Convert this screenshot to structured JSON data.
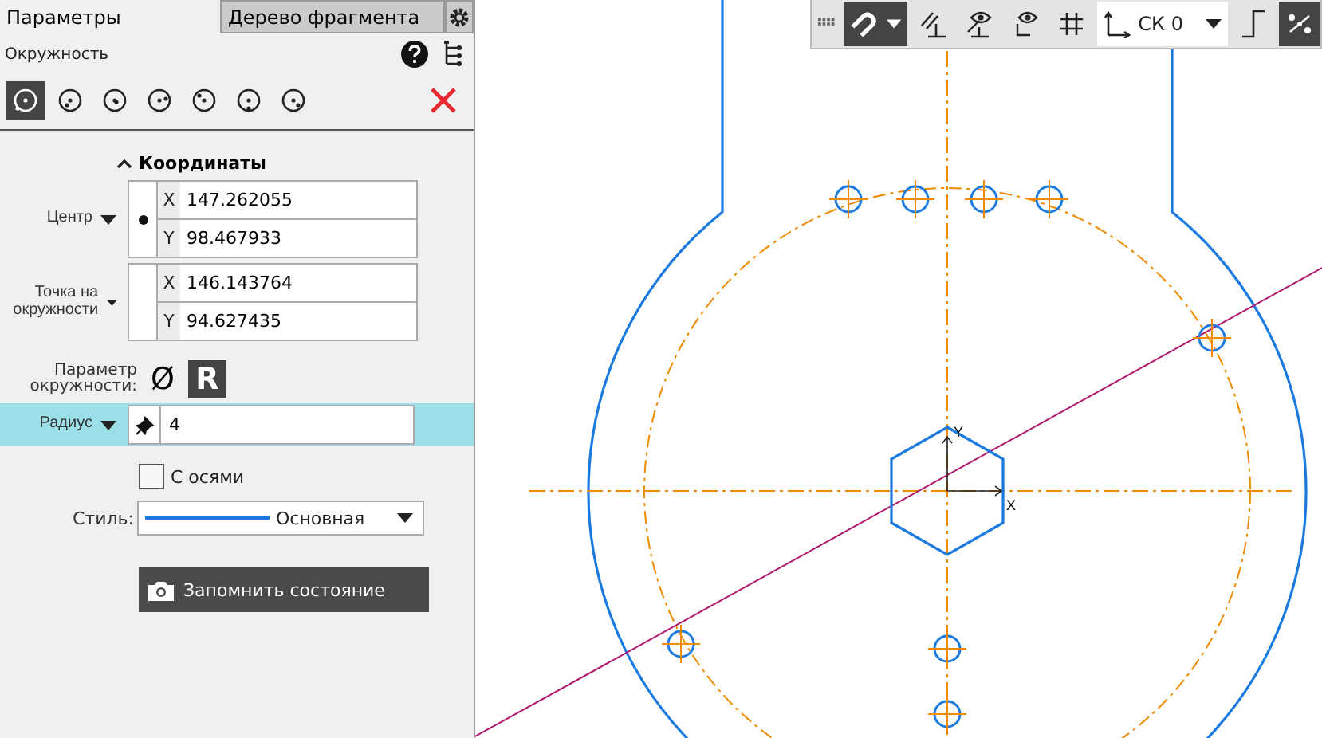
{
  "panel": {
    "tabs": [
      {
        "label": "Параметры",
        "selected": true
      },
      {
        "label": "Дерево фрагмента",
        "selected": false
      }
    ],
    "title": "Окружность",
    "modes": [
      {
        "selected": true
      },
      {
        "selected": false
      },
      {
        "selected": false
      },
      {
        "selected": false
      },
      {
        "selected": false
      },
      {
        "selected": false
      },
      {
        "selected": false
      }
    ],
    "section": {
      "title": "Координаты",
      "expanded": true
    },
    "point_groups": [
      {
        "label": "Центр",
        "has_point": true,
        "fields": [
          {
            "axis": "X",
            "value": "147.262055"
          },
          {
            "axis": "Y",
            "value": "98.467933"
          }
        ]
      },
      {
        "label": "Точка на окружности",
        "has_point": false,
        "fields": [
          {
            "axis": "X",
            "value": "146.143764"
          },
          {
            "axis": "Y",
            "value": "94.627435"
          }
        ]
      }
    ],
    "circle_param": {
      "label": "Параметр окружности:",
      "options": [
        {
          "label": "Ø",
          "selected": false
        },
        {
          "label": "R",
          "selected": true
        }
      ]
    },
    "radius": {
      "label": "Радиус",
      "value": "4"
    },
    "axes_checkbox": {
      "label": "С осями",
      "checked": false
    },
    "style": {
      "label": "Стиль:",
      "value": "Основная"
    },
    "save_button": "Запомнить состояние"
  },
  "toolbar": {
    "items": [
      {
        "kind": "magnet",
        "on": true
      },
      {
        "kind": "parallel",
        "on": false
      },
      {
        "kind": "eye-line",
        "on": false
      },
      {
        "kind": "eye-axes",
        "on": false
      },
      {
        "kind": "grid",
        "on": false
      },
      {
        "kind": "cs",
        "label": "СК 0"
      },
      {
        "kind": "step",
        "on": false
      },
      {
        "kind": "snap",
        "on": true
      }
    ]
  },
  "canvas": {
    "axis_labels": [
      "X",
      "Y"
    ]
  }
}
